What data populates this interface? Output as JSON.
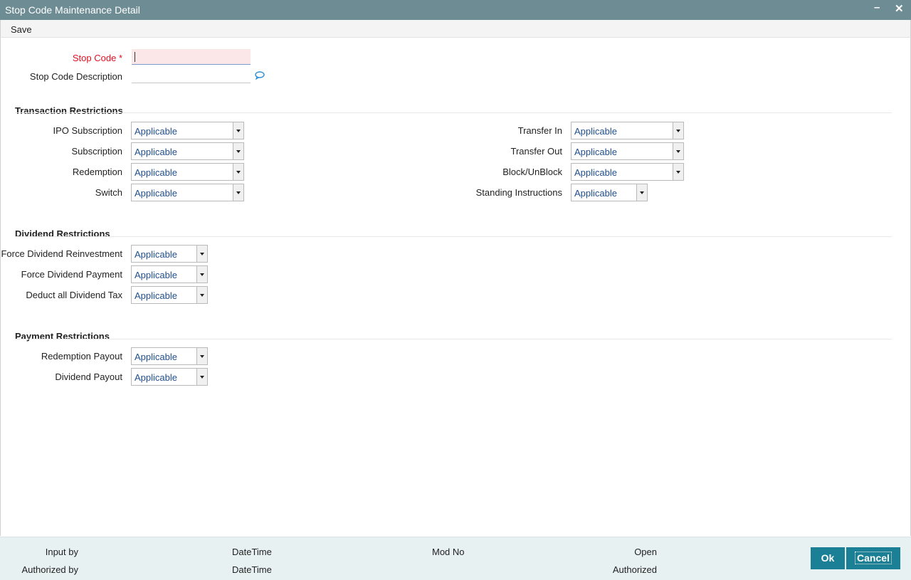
{
  "window": {
    "title": "Stop Code Maintenance Detail"
  },
  "toolbar": {
    "save_label": "Save"
  },
  "form": {
    "stop_code": {
      "label": "Stop Code",
      "required_mark": "*",
      "value": ""
    },
    "stop_code_description": {
      "label": "Stop Code Description",
      "value": ""
    }
  },
  "transaction_restrictions": {
    "title": "Transaction Restrictions",
    "left": [
      {
        "label": "IPO Subscription",
        "value": "Applicable"
      },
      {
        "label": "Subscription",
        "value": "Applicable"
      },
      {
        "label": "Redemption",
        "value": "Applicable"
      },
      {
        "label": "Switch",
        "value": "Applicable"
      }
    ],
    "right": [
      {
        "label": "Transfer In",
        "value": "Applicable"
      },
      {
        "label": "Transfer Out",
        "value": "Applicable"
      },
      {
        "label": "Block/UnBlock",
        "value": "Applicable"
      },
      {
        "label": "Standing Instructions",
        "value": "Applicable"
      }
    ]
  },
  "dividend_restrictions": {
    "title": "Dividend Restrictions",
    "items": [
      {
        "label": "Force Dividend Reinvestment",
        "value": "Applicable"
      },
      {
        "label": "Force Dividend Payment",
        "value": "Applicable"
      },
      {
        "label": "Deduct all Dividend Tax",
        "value": "Applicable"
      }
    ]
  },
  "payment_restrictions": {
    "title": "Payment Restrictions",
    "items": [
      {
        "label": "Redemption Payout",
        "value": "Applicable"
      },
      {
        "label": "Dividend Payout",
        "value": "Applicable"
      }
    ]
  },
  "footer": {
    "input_by": "Input by",
    "authorized_by": "Authorized by",
    "datetime_1": "DateTime",
    "datetime_2": "DateTime",
    "mod_no": "Mod No",
    "open": "Open",
    "authorized": "Authorized",
    "ok_label": "Ok",
    "cancel_label": "Cancel"
  }
}
